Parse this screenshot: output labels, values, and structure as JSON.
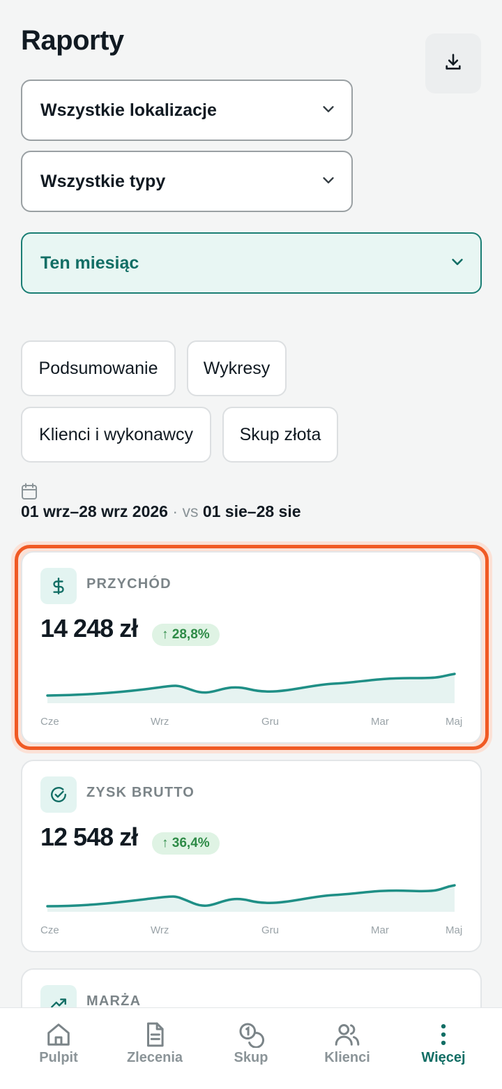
{
  "header": {
    "title": "Raporty"
  },
  "filters": {
    "location": "Wszystkie lokalizacje",
    "type": "Wszystkie typy",
    "period": "Ten miesiąc"
  },
  "tabs": [
    "Podsumowanie",
    "Wykresy",
    "Klienci i wykonawcy",
    "Skup złota"
  ],
  "date_range": {
    "current": "01 wrz–28 wrz 2026",
    "separator": "·",
    "vs": "vs",
    "previous": "01 sie–28 sie"
  },
  "cards": [
    {
      "title": "PRZYCHÓD",
      "value": "14 248 zł",
      "change": "↑ 28,8%",
      "icon": "dollar-icon",
      "months": [
        "Cze",
        "Wrz",
        "Gru",
        "Mar",
        "Maj"
      ]
    },
    {
      "title": "ZYSK BRUTTO",
      "value": "12 548 zł",
      "change": "↑ 36,4%",
      "icon": "check-circle-icon",
      "months": [
        "Cze",
        "Wrz",
        "Gru",
        "Mar",
        "Maj"
      ]
    },
    {
      "title": "MARŻA",
      "icon": "trending-up-icon"
    }
  ],
  "nav": [
    {
      "label": "Pulpit",
      "icon": "home-icon"
    },
    {
      "label": "Zlecenia",
      "icon": "document-icon"
    },
    {
      "label": "Skup",
      "icon": "coins-icon"
    },
    {
      "label": "Klienci",
      "icon": "users-icon"
    },
    {
      "label": "Więcej",
      "icon": "more-vertical-icon",
      "active": true
    }
  ],
  "colors": {
    "accent": "#126e65",
    "chart_line": "#1f8f86",
    "highlight": "#f05a24",
    "positive": "#2e8b47"
  }
}
